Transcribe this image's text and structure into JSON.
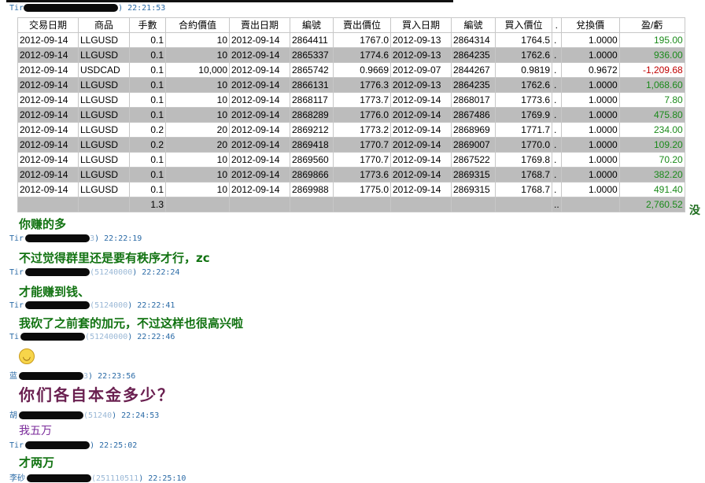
{
  "first_meta": {
    "name": "Tir",
    "time": ") 22:21:53"
  },
  "table": {
    "headers": [
      "交易日期",
      "商品",
      "手數",
      "合約價值",
      "賣出日期",
      "編號",
      "賣出價位",
      "買入日期",
      "編號",
      "買入價位",
      ".",
      "兌換價",
      "盈/虧"
    ],
    "rows": [
      {
        "date": "2012-09-14",
        "symbol": "LLGUSD",
        "lots": "0.1",
        "value": "10",
        "sell_date": "2012-09-14",
        "sell_no": "2864411",
        "sell_price": "1767.0",
        "buy_date": "2012-09-13",
        "buy_no": "2864314",
        "buy_price": "1764.5",
        "dot": ".",
        "rate": "1.0000",
        "pl": "195.00",
        "pl_sign": "pos"
      },
      {
        "date": "2012-09-14",
        "symbol": "LLGUSD",
        "lots": "0.1",
        "value": "10",
        "sell_date": "2012-09-14",
        "sell_no": "2865337",
        "sell_price": "1774.6",
        "buy_date": "2012-09-13",
        "buy_no": "2864235",
        "buy_price": "1762.6",
        "dot": ".",
        "rate": "1.0000",
        "pl": "936.00",
        "pl_sign": "pos"
      },
      {
        "date": "2012-09-14",
        "symbol": "USDCAD",
        "lots": "0.1",
        "value": "10,000",
        "sell_date": "2012-09-14",
        "sell_no": "2865742",
        "sell_price": "0.9669",
        "buy_date": "2012-09-07",
        "buy_no": "2844267",
        "buy_price": "0.9819",
        "dot": ".",
        "rate": "0.9672",
        "pl": "-1,209.68",
        "pl_sign": "neg"
      },
      {
        "date": "2012-09-14",
        "symbol": "LLGUSD",
        "lots": "0.1",
        "value": "10",
        "sell_date": "2012-09-14",
        "sell_no": "2866131",
        "sell_price": "1776.3",
        "buy_date": "2012-09-13",
        "buy_no": "2864235",
        "buy_price": "1762.6",
        "dot": ".",
        "rate": "1.0000",
        "pl": "1,068.60",
        "pl_sign": "pos"
      },
      {
        "date": "2012-09-14",
        "symbol": "LLGUSD",
        "lots": "0.1",
        "value": "10",
        "sell_date": "2012-09-14",
        "sell_no": "2868117",
        "sell_price": "1773.7",
        "buy_date": "2012-09-14",
        "buy_no": "2868017",
        "buy_price": "1773.6",
        "dot": ".",
        "rate": "1.0000",
        "pl": "7.80",
        "pl_sign": "pos"
      },
      {
        "date": "2012-09-14",
        "symbol": "LLGUSD",
        "lots": "0.1",
        "value": "10",
        "sell_date": "2012-09-14",
        "sell_no": "2868289",
        "sell_price": "1776.0",
        "buy_date": "2012-09-14",
        "buy_no": "2867486",
        "buy_price": "1769.9",
        "dot": ".",
        "rate": "1.0000",
        "pl": "475.80",
        "pl_sign": "pos"
      },
      {
        "date": "2012-09-14",
        "symbol": "LLGUSD",
        "lots": "0.2",
        "value": "20",
        "sell_date": "2012-09-14",
        "sell_no": "2869212",
        "sell_price": "1773.2",
        "buy_date": "2012-09-14",
        "buy_no": "2868969",
        "buy_price": "1771.7",
        "dot": ".",
        "rate": "1.0000",
        "pl": "234.00",
        "pl_sign": "pos"
      },
      {
        "date": "2012-09-14",
        "symbol": "LLGUSD",
        "lots": "0.2",
        "value": "20",
        "sell_date": "2012-09-14",
        "sell_no": "2869418",
        "sell_price": "1770.7",
        "buy_date": "2012-09-14",
        "buy_no": "2869007",
        "buy_price": "1770.0",
        "dot": ".",
        "rate": "1.0000",
        "pl": "109.20",
        "pl_sign": "pos"
      },
      {
        "date": "2012-09-14",
        "symbol": "LLGUSD",
        "lots": "0.1",
        "value": "10",
        "sell_date": "2012-09-14",
        "sell_no": "2869560",
        "sell_price": "1770.7",
        "buy_date": "2012-09-14",
        "buy_no": "2867522",
        "buy_price": "1769.8",
        "dot": ".",
        "rate": "1.0000",
        "pl": "70.20",
        "pl_sign": "pos"
      },
      {
        "date": "2012-09-14",
        "symbol": "LLGUSD",
        "lots": "0.1",
        "value": "10",
        "sell_date": "2012-09-14",
        "sell_no": "2869866",
        "sell_price": "1773.6",
        "buy_date": "2012-09-14",
        "buy_no": "2869315",
        "buy_price": "1768.7",
        "dot": ".",
        "rate": "1.0000",
        "pl": "382.20",
        "pl_sign": "pos"
      },
      {
        "date": "2012-09-14",
        "symbol": "LLGUSD",
        "lots": "0.1",
        "value": "10",
        "sell_date": "2012-09-14",
        "sell_no": "2869988",
        "sell_price": "1775.0",
        "buy_date": "2012-09-14",
        "buy_no": "2869315",
        "buy_price": "1768.7",
        "dot": ".",
        "rate": "1.0000",
        "pl": "491.40",
        "pl_sign": "pos"
      }
    ],
    "total": {
      "lots": "1.3",
      "dot": "..",
      "pl": "2,760.52"
    }
  },
  "tail_char": "没",
  "colors": {
    "profit": "#1a8a1a",
    "loss": "#c00000",
    "chat_green": "#127312",
    "meta_blue": "#2a6aa6",
    "row_gray": "#bcbcbc"
  },
  "chat": [
    {
      "type": "text",
      "text": "你赚的多"
    },
    {
      "type": "meta",
      "name": "Tir",
      "mid": "3",
      "time": ") 22:22:19"
    },
    {
      "type": "text",
      "text": "不过觉得群里还是要有秩序才行，zc"
    },
    {
      "type": "meta",
      "name": "Tir",
      "mid": "(51240000",
      "time": ") 22:22:24"
    },
    {
      "type": "text",
      "text": "才能赚到钱、"
    },
    {
      "type": "meta",
      "name": "Tir",
      "mid": "(5124000",
      "time": ") 22:22:41"
    },
    {
      "type": "text",
      "text": "我砍了之前套的加元，不过这样也很高兴啦"
    },
    {
      "type": "meta",
      "name": "Ti",
      "mid": "(51240000",
      "time": ") 22:22:46"
    },
    {
      "type": "emoji",
      "icon": "grin-emoji-icon"
    },
    {
      "type": "meta",
      "name": "蓝",
      "mid": "3",
      "time": ") 22:23:56"
    },
    {
      "type": "text",
      "style": "big",
      "text": "你们各自本金多少？"
    },
    {
      "type": "meta",
      "name": "胡",
      "mid": "(51240",
      "time": ") 22:24:53"
    },
    {
      "type": "text",
      "style": "purple",
      "text": "我五万"
    },
    {
      "type": "meta",
      "name": "Tir",
      "mid": "",
      "time": ") 22:25:02"
    },
    {
      "type": "text",
      "text": "才两万"
    },
    {
      "type": "meta",
      "name": "李砂",
      "mid": "(251110511",
      "time": ") 22:25:10"
    }
  ]
}
